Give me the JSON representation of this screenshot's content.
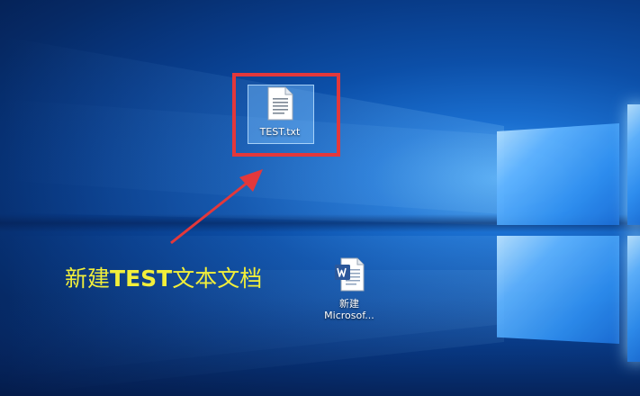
{
  "desktop": {
    "icons": [
      {
        "label": "TEST.txt",
        "icon": "text-file-icon",
        "selected": true
      },
      {
        "label_line1": "新建",
        "label_line2": "Microsof...",
        "icon": "word-document-icon",
        "selected": false
      }
    ]
  },
  "annotation": {
    "text_prefix": "新建",
    "text_bold": "TEST",
    "text_suffix": "文本文档",
    "color": "#f2ef3a",
    "highlight_color": "#e3383b"
  },
  "wallpaper": {
    "name": "windows-10-hero-wallpaper",
    "base_color": "#0c4fa8",
    "light_color": "#8fd0ff"
  }
}
